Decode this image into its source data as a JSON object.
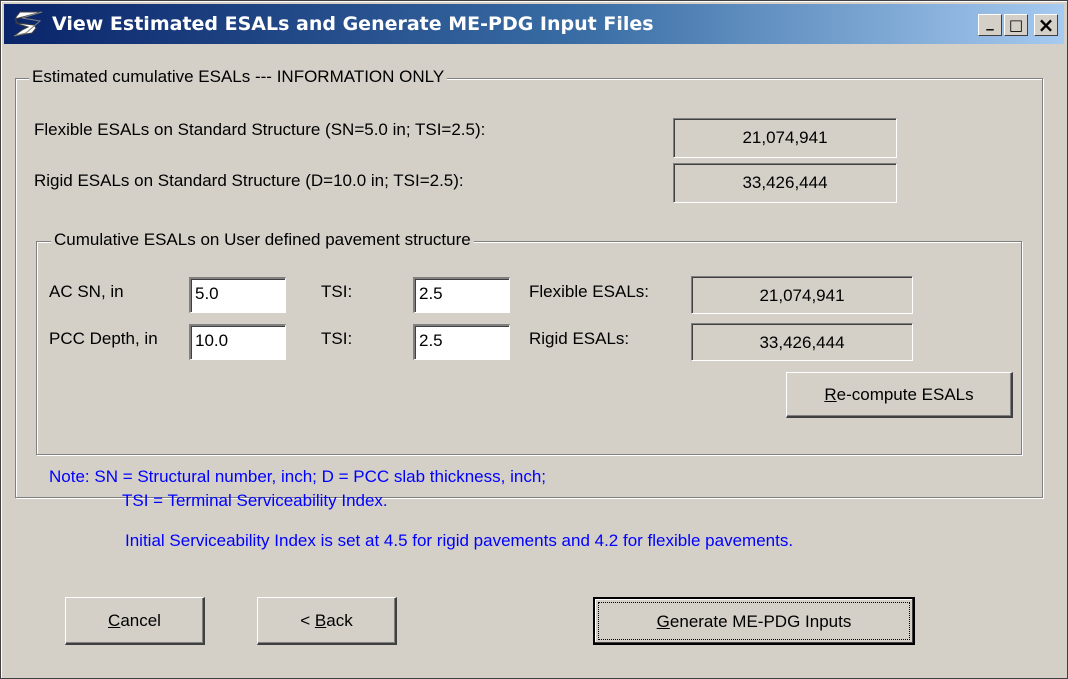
{
  "window": {
    "title": "View Estimated ESALs and Generate ME-PDG Input Files",
    "controls": {
      "minimize": "_",
      "maximize": "□",
      "close": "×"
    }
  },
  "estimated": {
    "group_label": "Estimated cumulative ESALs --- INFORMATION ONLY",
    "flexible_label": "Flexible ESALs on Standard Structure (SN=5.0 in; TSI=2.5):",
    "flexible_value": "21,074,941",
    "rigid_label": "Rigid ESALs on Standard Structure (D=10.0 in; TSI=2.5):",
    "rigid_value": "33,426,444"
  },
  "user_defined": {
    "group_label": "Cumulative ESALs on User defined pavement structure",
    "ac_sn_label": "AC SN, in",
    "ac_sn_value": "5.0",
    "tsi_label_1": "TSI:",
    "tsi_value_1": "2.5",
    "flexible_label": "Flexible ESALs:",
    "flexible_value": "21,074,941",
    "pcc_depth_label": "PCC Depth, in",
    "pcc_depth_value": "10.0",
    "tsi_label_2": "TSI:",
    "tsi_value_2": "2.5",
    "rigid_label": "Rigid ESALs:",
    "rigid_value": "33,426,444",
    "recompute_label_u": "R",
    "recompute_label_rest": "e-compute ESALs"
  },
  "note": {
    "line1": "Note:   SN = Structural number, inch;  D = PCC slab thickness, inch;",
    "line2": "TSI = Terminal Serviceability Index.",
    "line3": "Initial Serviceability Index is set at 4.5 for rigid pavements and 4.2 for flexible pavements."
  },
  "buttons": {
    "cancel_u": "C",
    "cancel_rest": "ancel",
    "back_pre": "< ",
    "back_u": "B",
    "back_rest": "ack",
    "generate_u": "G",
    "generate_rest": "enerate ME-PDG Inputs"
  },
  "colors": {
    "note": "#0000ff",
    "title_start": "#0a246a",
    "title_end": "#a6caf0",
    "face": "#d4d0c8"
  },
  "icons": [
    "app-s-logo-icon",
    "minimize-icon",
    "maximize-icon",
    "close-icon"
  ]
}
